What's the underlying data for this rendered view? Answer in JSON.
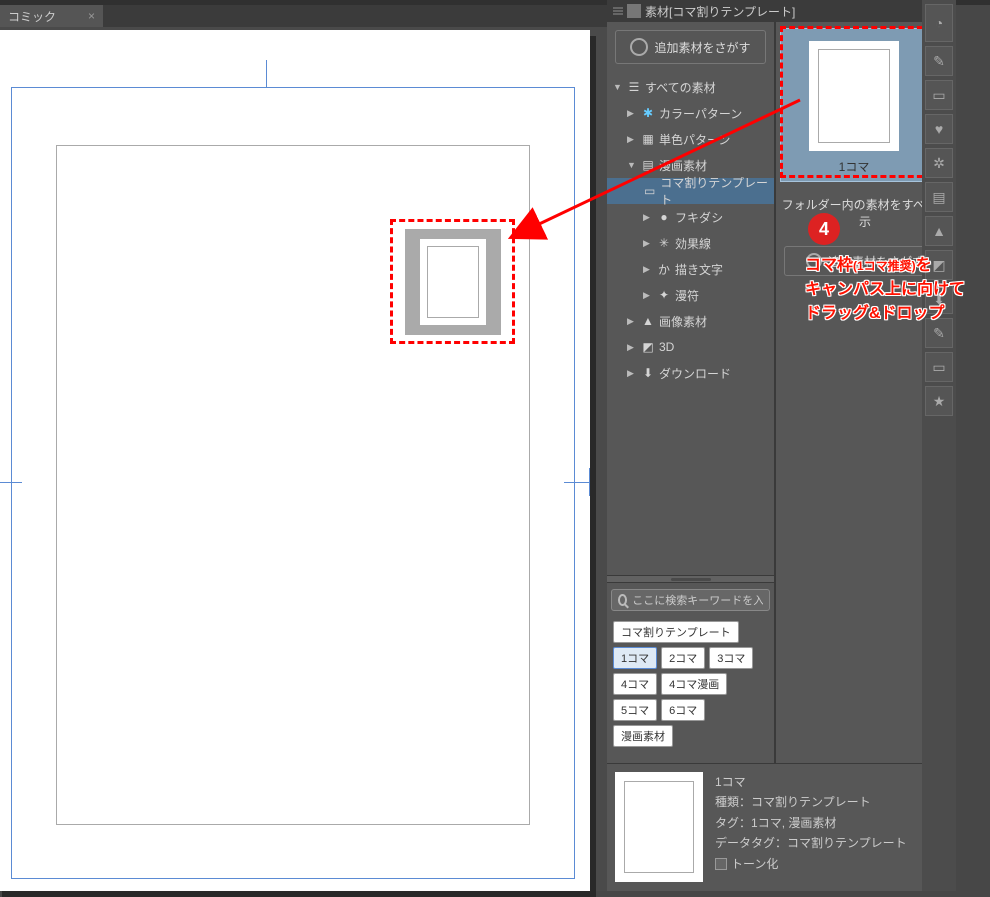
{
  "doc_tab": {
    "label": "コミック",
    "close": "×"
  },
  "panel_header": {
    "title": "素材[コマ割りテンプレート]"
  },
  "add_material_btn": {
    "label": "追加素材をさがす"
  },
  "tree": {
    "root": "すべての素材",
    "items": [
      {
        "label": "カラーパターン"
      },
      {
        "label": "単色パターン"
      },
      {
        "label": "漫画素材"
      },
      {
        "label": "コマ割りテンプレート"
      },
      {
        "label": "フキダシ"
      },
      {
        "label": "効果線"
      },
      {
        "label": "描き文字"
      },
      {
        "label": "漫符"
      },
      {
        "label": "画像素材"
      },
      {
        "label": "3D"
      },
      {
        "label": "ダウンロード"
      }
    ]
  },
  "search": {
    "placeholder": "ここに検索キーワードを入力してくださ"
  },
  "tags": [
    "コマ割りテンプレート",
    "1コマ",
    "2コマ",
    "3コマ",
    "4コマ",
    "4コマ漫画",
    "5コマ",
    "6コマ",
    "漫画素材"
  ],
  "preview": {
    "thumb_label": "1コマ",
    "show_all": "フォルダー内の素材をすべて表示",
    "add_btn": "追加素材をさがす"
  },
  "annotation": {
    "badge": "4",
    "line1a": "コマ枠",
    "line1b": "(1コマ推奨)",
    "line1c": "を",
    "line2": "キャンパス上に向けて",
    "line3": "ドラッグ&ドロップ"
  },
  "detail": {
    "name": "1コマ",
    "type_label": "種類：",
    "type_value": "コマ割りテンプレート",
    "tag_label": "タグ：",
    "tag_value": "1コマ, 漫画素材",
    "datatag_label": "データタグ：",
    "datatag_value": "コマ割りテンプレート",
    "tone_label": "トーン化"
  }
}
